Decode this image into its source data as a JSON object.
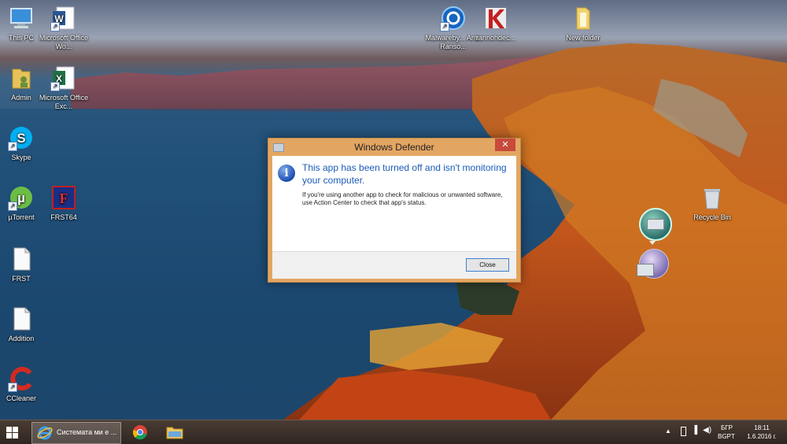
{
  "desktop_icons": [
    {
      "label": "This PC"
    },
    {
      "label": "Microsoft Office Wo..."
    },
    {
      "label": "Admin"
    },
    {
      "label": "Microsoft Office Exc..."
    },
    {
      "label": "Skype"
    },
    {
      "label": "µTorrent"
    },
    {
      "label": "FRST64"
    },
    {
      "label": "FRST"
    },
    {
      "label": "Addition"
    },
    {
      "label": "CCleaner"
    },
    {
      "label": "Malwareby... Anti-Ranso..."
    },
    {
      "label": "rannohdec..."
    },
    {
      "label": "New folder"
    },
    {
      "label": "Recycle Bin"
    }
  ],
  "dialog": {
    "title": "Windows Defender",
    "close_glyph": "✕",
    "heading": "This app has been turned off and isn't monitoring your computer.",
    "body": "If you're using another app to check for malicious or unwanted software, use Action Center to check that app's status.",
    "button_label": "Close"
  },
  "taskbar": {
    "ie_label": "Системата ми е ...",
    "language": "БГР",
    "language_sub": "BGPT",
    "time": "18:11",
    "date": "1.6.2016 г."
  },
  "colors": {
    "dialog_frame": "#e3a662",
    "heading_blue": "#1c5cb8",
    "close_red": "#c84a3b",
    "button_border": "#3c7fd7"
  }
}
